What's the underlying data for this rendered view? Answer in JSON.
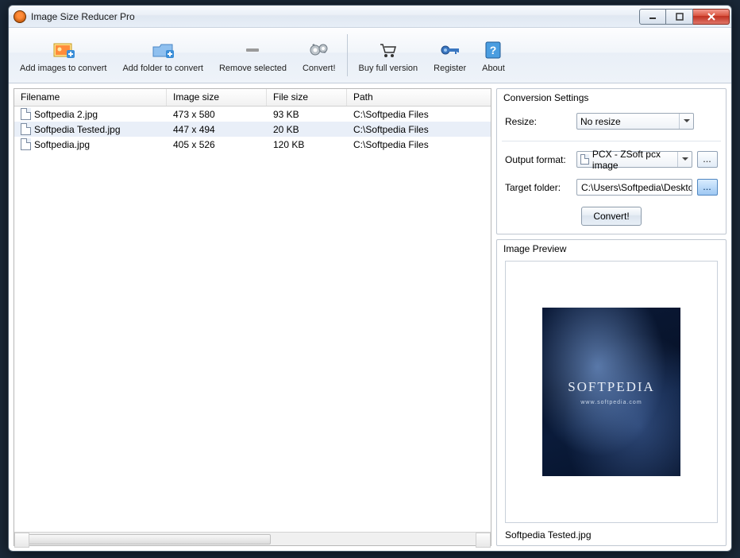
{
  "window": {
    "title": "Image Size Reducer Pro"
  },
  "toolbar": {
    "add_images": "Add images to convert",
    "add_folder": "Add folder to convert",
    "remove": "Remove selected",
    "convert": "Convert!",
    "buy": "Buy full version",
    "register": "Register",
    "about": "About"
  },
  "list": {
    "columns": {
      "filename": "Filename",
      "image_size": "Image size",
      "file_size": "File size",
      "path": "Path"
    },
    "rows": [
      {
        "filename": "Softpedia 2.jpg",
        "image_size": "473 x 580",
        "file_size": "93 KB",
        "path": "C:\\Softpedia Files",
        "selected": false
      },
      {
        "filename": "Softpedia Tested.jpg",
        "image_size": "447 x 494",
        "file_size": "20 KB",
        "path": "C:\\Softpedia Files",
        "selected": true
      },
      {
        "filename": "Softpedia.jpg",
        "image_size": "405 x 526",
        "file_size": "120 KB",
        "path": "C:\\Softpedia Files",
        "selected": false
      }
    ]
  },
  "settings": {
    "panel_title": "Conversion Settings",
    "resize_label": "Resize:",
    "resize_value": "No resize",
    "format_label": "Output format:",
    "format_value": "PCX - ZSoft pcx image",
    "target_label": "Target folder:",
    "target_value": "C:\\Users\\Softpedia\\Desktop",
    "ellipsis": "...",
    "convert_button": "Convert!"
  },
  "preview": {
    "panel_title": "Image Preview",
    "brand": "SOFTPEDIA",
    "url": "www.softpedia.com",
    "filename": "Softpedia Tested.jpg"
  }
}
